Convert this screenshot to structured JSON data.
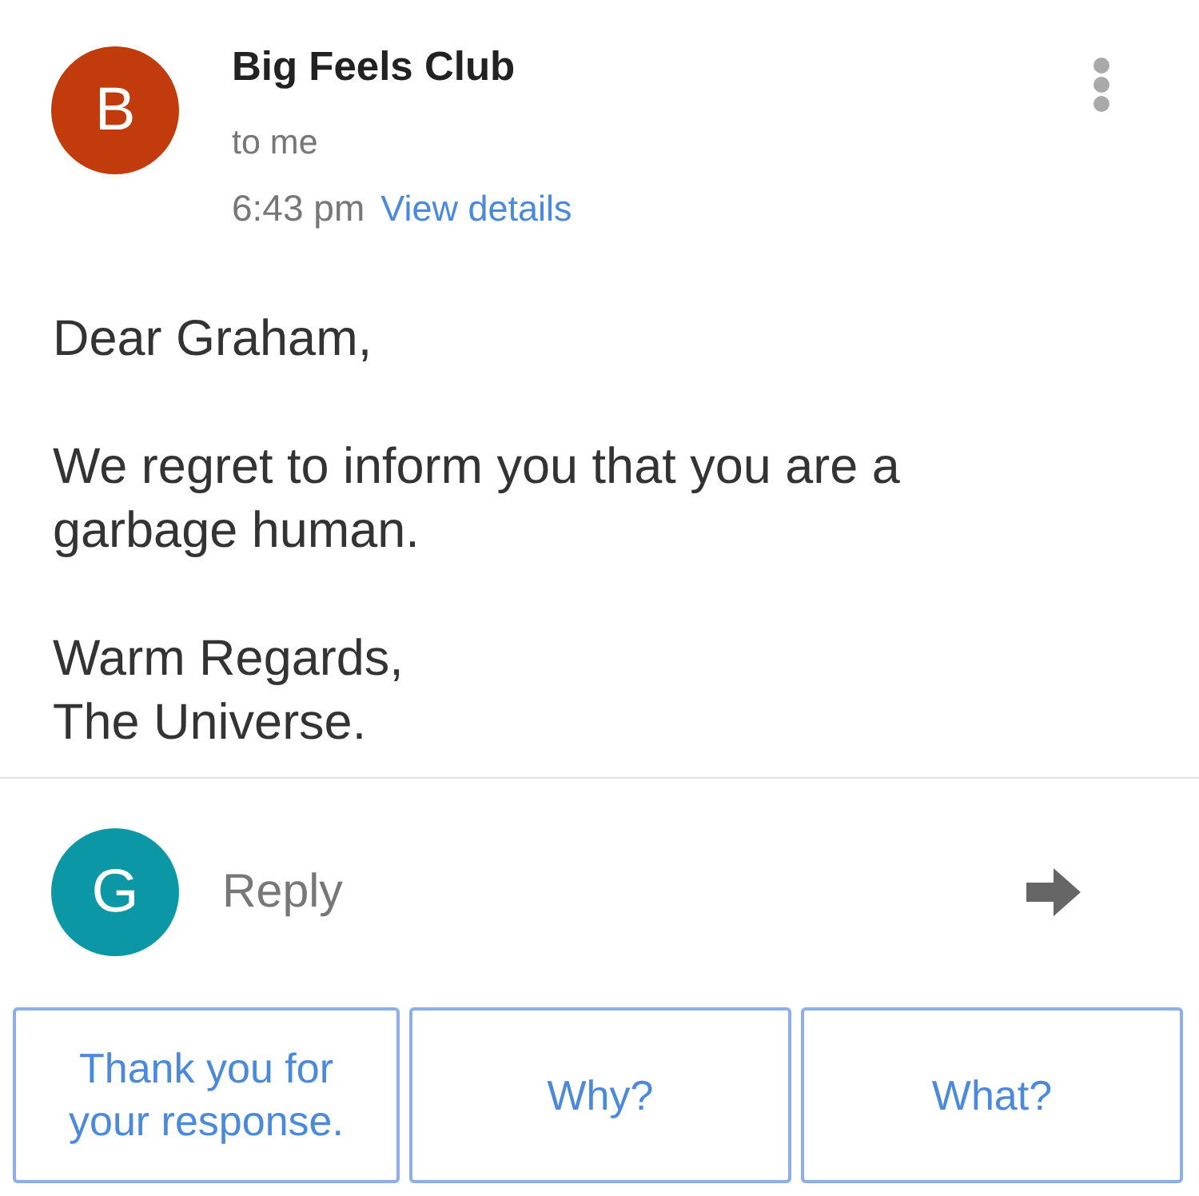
{
  "message": {
    "sender": {
      "avatar_letter": "B",
      "name": "Big Feels Club",
      "recipient": "to me",
      "time": "6:43 pm",
      "details_link": "View details"
    },
    "body": [
      "Dear Graham,",
      "We regret to inform you that you are a garbage human.",
      "Warm Regards,\nThe Universe."
    ]
  },
  "reply": {
    "avatar_letter": "G",
    "placeholder": "Reply"
  },
  "smart_replies": [
    "Thank you for your response.",
    "Why?",
    "What?"
  ]
}
